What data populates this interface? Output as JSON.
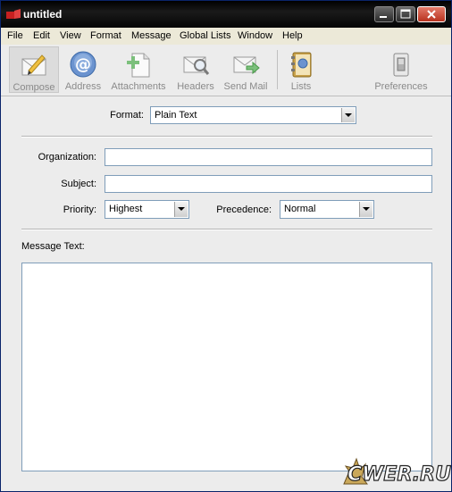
{
  "window": {
    "title": "untitled"
  },
  "menu": [
    "File",
    "Edit",
    "View",
    "Format",
    "Message",
    "Global Lists",
    "Window",
    "Help"
  ],
  "toolbar": {
    "compose": "Compose",
    "address": "Address",
    "attachments": "Attachments",
    "headers": "Headers",
    "send_mail": "Send Mail",
    "lists": "Lists",
    "preferences": "Preferences"
  },
  "form": {
    "format_label": "Format:",
    "format_value": "Plain Text",
    "organization_label": "Organization:",
    "organization_value": "",
    "subject_label": "Subject:",
    "subject_value": "",
    "priority_label": "Priority:",
    "priority_value": "Highest",
    "precedence_label": "Precedence:",
    "precedence_value": "Normal",
    "message_label": "Message Text:",
    "message_value": ""
  },
  "watermark": "CWER.RU"
}
